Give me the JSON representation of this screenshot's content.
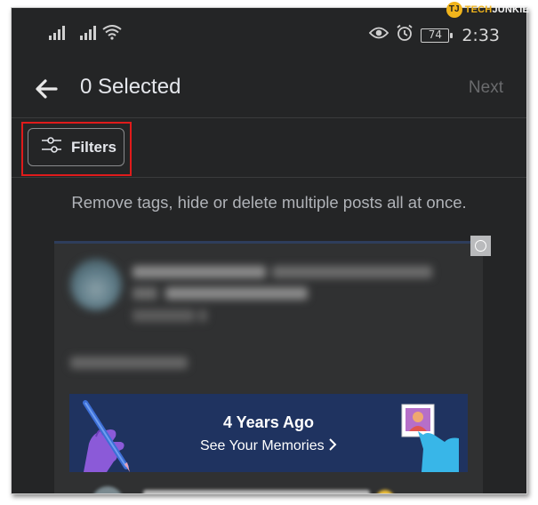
{
  "watermark": {
    "prefix": "TECH",
    "suffix": "JUNKIE",
    "badge": "TJ"
  },
  "statusbar": {
    "battery": "74",
    "time": "2:33",
    "icons": [
      "signal-icon",
      "signal-icon",
      "wifi-icon",
      "eye-icon",
      "alarm-icon",
      "battery-icon"
    ]
  },
  "header": {
    "title": "0 Selected",
    "next_label": "Next"
  },
  "filters": {
    "label": "Filters",
    "icon": "sliders-icon"
  },
  "description": "Remove tags, hide or delete multiple posts all at once.",
  "post": {
    "memories": {
      "title": "4 Years Ago",
      "link": "See Your Memories",
      "link_icon": "chevron-right-icon"
    }
  },
  "colors": {
    "background": "#242526",
    "primary_text": "#e4e6eb",
    "secondary_text": "#b0b3b8",
    "disabled_text": "#6a6b6d",
    "highlight": "#e01b1b",
    "memories_bg": "#1f3360"
  }
}
